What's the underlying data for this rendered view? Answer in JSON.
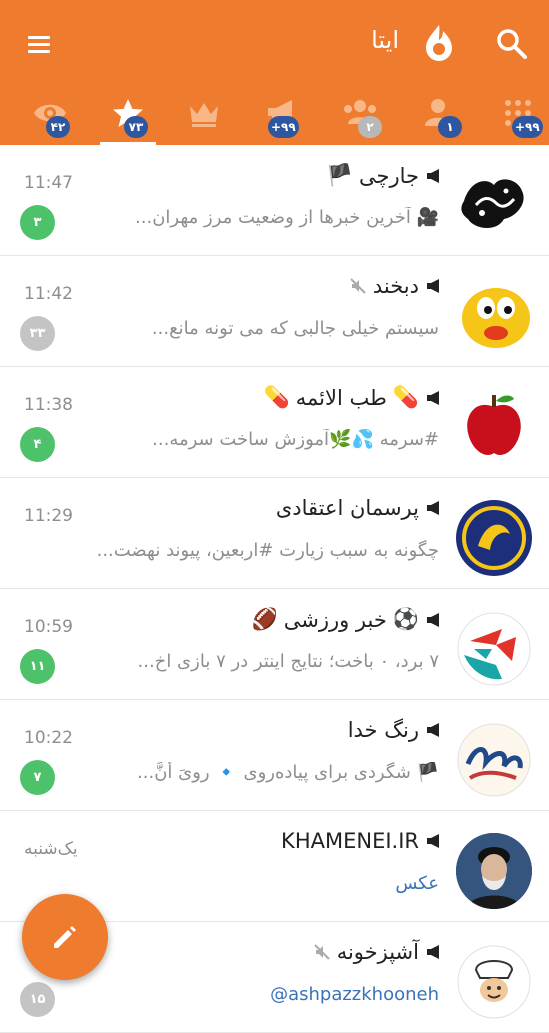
{
  "app": {
    "title": "ایتا",
    "accent": "#ef7b2e",
    "icons": {
      "menu": "hamburger-icon",
      "logo": "eitaa-flame-icon",
      "search": "search-icon",
      "compose": "pencil-icon"
    }
  },
  "tabs": [
    {
      "icon": "eye-icon",
      "badge": "۴۲",
      "badge_color": "#2f57a0"
    },
    {
      "icon": "star-icon",
      "badge": "۷۳",
      "badge_color": "#2f57a0",
      "selected": true
    },
    {
      "icon": "crown-icon",
      "badge": ""
    },
    {
      "icon": "megaphone-icon",
      "badge": "+۹۹",
      "badge_color": "#2f57a0"
    },
    {
      "icon": "group-icon",
      "badge": "۲",
      "badge_color": "#b8b8b8"
    },
    {
      "icon": "person-icon",
      "badge": "۱",
      "badge_color": "#2f57a0"
    },
    {
      "icon": "grid-icon",
      "badge": "+۹۹",
      "badge_color": "#2f57a0"
    }
  ],
  "chats": [
    {
      "name": "جارچی",
      "emoji_after": "🏴",
      "time": "11:47",
      "preview": "🎥 آخرین خبرها از وضعیت مرز مهران...",
      "count": "۳",
      "count_color": "#4dc26b",
      "avatar": "jarchi-logo"
    },
    {
      "name": "دبخند",
      "muted": true,
      "time": "11:42",
      "preview": "سیستم خیلی جالبی که می تونه مانع...",
      "count": "۳۳",
      "count_color": "#c4c4c4",
      "avatar": "smiley-face"
    },
    {
      "name": "طب الائمه",
      "emoji_before": "💊",
      "emoji_after": "💊",
      "time": "11:38",
      "preview": "#سرمه 💦🌿آموزش ساخت سرمه...",
      "count": "۴",
      "count_color": "#4dc26b",
      "avatar": "red-apple"
    },
    {
      "name": "پرسمان اعتقادی",
      "time": "11:29",
      "preview": "چگونه به سبب زیارت #اربعین، پیوند نهضت...",
      "count": "",
      "avatar": "porseman-logo"
    },
    {
      "name": "خبر ورزشی",
      "emoji_before": "⚽",
      "emoji_after": "🏈",
      "time": "10:59",
      "preview": "۷ برد، ۰ باخت؛ نتایج اینتر در ۷ بازی اخ...",
      "count": "۱۱",
      "count_color": "#4dc26b",
      "avatar": "sport-logo"
    },
    {
      "name": "رنگ خدا",
      "time": "10:22",
      "preview": "🏴 شگردی برای پیاده‌روی  🔹 رِوِیَ أنَّ...",
      "count": "۷",
      "count_color": "#4dc26b",
      "avatar": "rang-khoda-calligraphy"
    },
    {
      "name": "KHAMENEI.IR",
      "time": "یک‌شنبه",
      "preview": "عکس",
      "preview_link": true,
      "count": "",
      "avatar": "portrait"
    },
    {
      "name": "آشپزخونه",
      "muted": true,
      "time": "",
      "preview": "@ashpazzkhooneh",
      "preview_link": true,
      "count": "۱۵",
      "count_color": "#c4c4c4",
      "avatar": "cooking-logo"
    }
  ]
}
